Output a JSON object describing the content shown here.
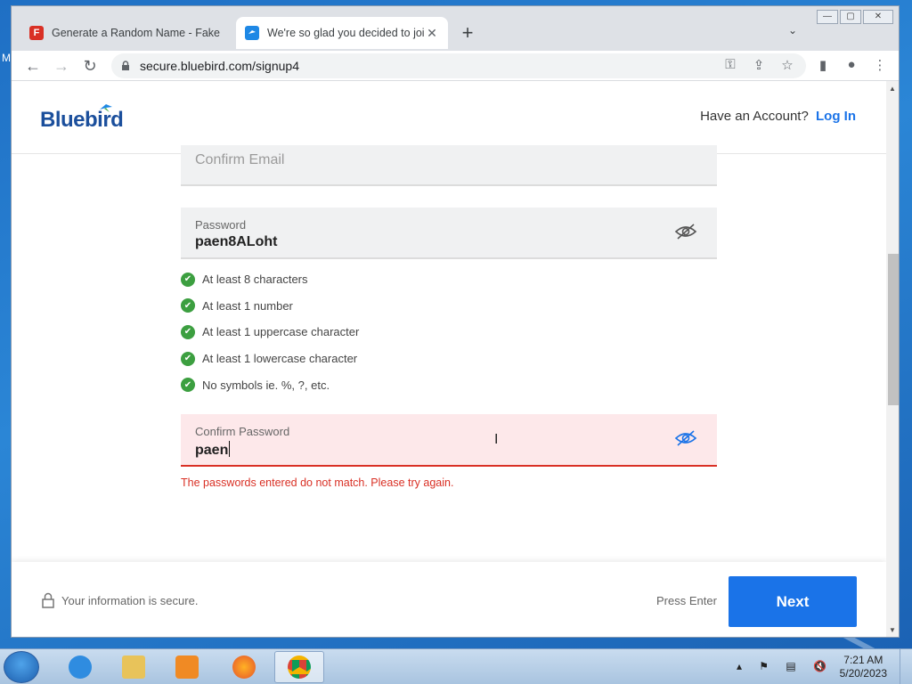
{
  "desktop": {
    "label_fragment": "M"
  },
  "browser": {
    "tabs": [
      {
        "title": "Generate a Random Name - Fake",
        "favicon_text": "F",
        "active": false
      },
      {
        "title": "We're so glad you decided to join",
        "favicon_text": "",
        "active": true
      }
    ],
    "new_tab_label": "+",
    "tab_search_label": "⌄",
    "address": "secure.bluebird.com/signup4",
    "nav": {
      "back": "←",
      "forward": "→",
      "reload": "↻"
    },
    "omnibox_icons": {
      "key": "⚿",
      "share": "⇪",
      "bookmark": "☆"
    },
    "toolbar_icons": {
      "sidebar": "▮",
      "profile": "●",
      "menu": "⋮"
    },
    "window_controls": {
      "minimize": "—",
      "maximize": "▢",
      "close": "✕"
    }
  },
  "header": {
    "logo_text": "Bluebird",
    "account_prompt": "Have an Account?",
    "login_link": "Log In"
  },
  "form": {
    "confirm_email": {
      "placeholder": "Confirm Email"
    },
    "password": {
      "label": "Password",
      "value": "paen8ALoht"
    },
    "rules": [
      "At least 8 characters",
      "At least 1 number",
      "At least 1 uppercase character",
      "At least 1 lowercase character",
      "No symbols ie. %, ?, etc."
    ],
    "confirm_password": {
      "label": "Confirm Password",
      "value": "paen"
    },
    "error_message": "The passwords entered do not match. Please try again."
  },
  "footer": {
    "secure_text": "Your information is secure.",
    "press_enter": "Press Enter",
    "next_label": "Next"
  },
  "taskbar": {
    "time": "7:21 AM",
    "date": "5/20/2023",
    "tray_icons": "▴ ⚑ ▤ 🔇"
  },
  "colors": {
    "accent": "#1a73e8",
    "brand": "#1b4f9c",
    "error": "#d93025",
    "success": "#3c9f40"
  }
}
